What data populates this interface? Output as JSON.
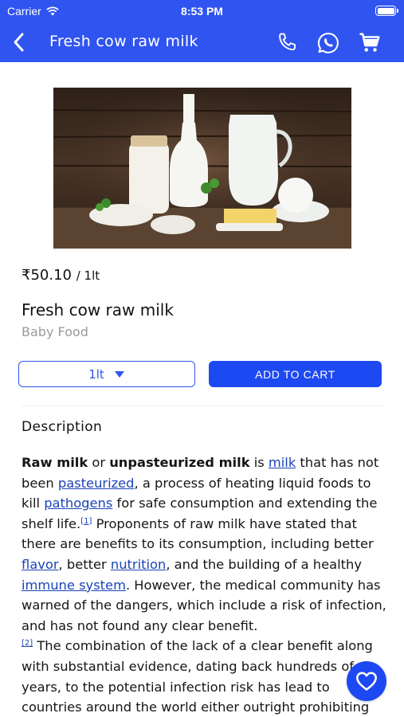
{
  "status_bar": {
    "carrier": "Carrier",
    "time": "8:53 PM"
  },
  "app_bar": {
    "title": "Fresh cow raw milk",
    "icons": [
      "back-arrow-icon",
      "phone-icon",
      "whatsapp-icon",
      "cart-icon"
    ]
  },
  "product": {
    "price": "₹50.10",
    "price_unit": "/ 1lt",
    "name": "Fresh cow raw milk",
    "category": "Baby Food",
    "selected_unit": "1lt",
    "add_to_cart_label": "ADD TO CART"
  },
  "description": {
    "heading": "Description",
    "segments": {
      "s1": "Raw milk",
      "s2": " or ",
      "s3": "unpasteurized milk",
      "s4": " is ",
      "link_milk": "milk",
      "s5": " that has not been ",
      "link_pasteurized": "pasteurized",
      "s6": ", a process of heating liquid foods to kill ",
      "link_pathogens": "pathogens",
      "s7": " for safe consumption and extending the shelf life.",
      "ref1": "[1]",
      "s8": " Proponents of raw milk have stated that there are benefits to its consumption, including better ",
      "link_flavor": "flavor",
      "s9": ", better ",
      "link_nutrition": "nutrition",
      "s10": ", and the building of a healthy ",
      "link_immune": "immune system",
      "s11": ". However, the medical community has warned of the dangers, which include a risk of infection, and has not found any clear benefit.",
      "ref2": "[2]",
      "s12": " The combination of the lack of a clear benefit along with substantial evidence, dating back hundreds of years, to the potential infection risk has lead to countries around the world either outright prohibiting"
    }
  },
  "colors": {
    "primary": "#2f54f0",
    "button": "#1d49f2",
    "link": "#1a44b8",
    "category": "#9a9a9a"
  },
  "favorite_icon": "heart-icon"
}
